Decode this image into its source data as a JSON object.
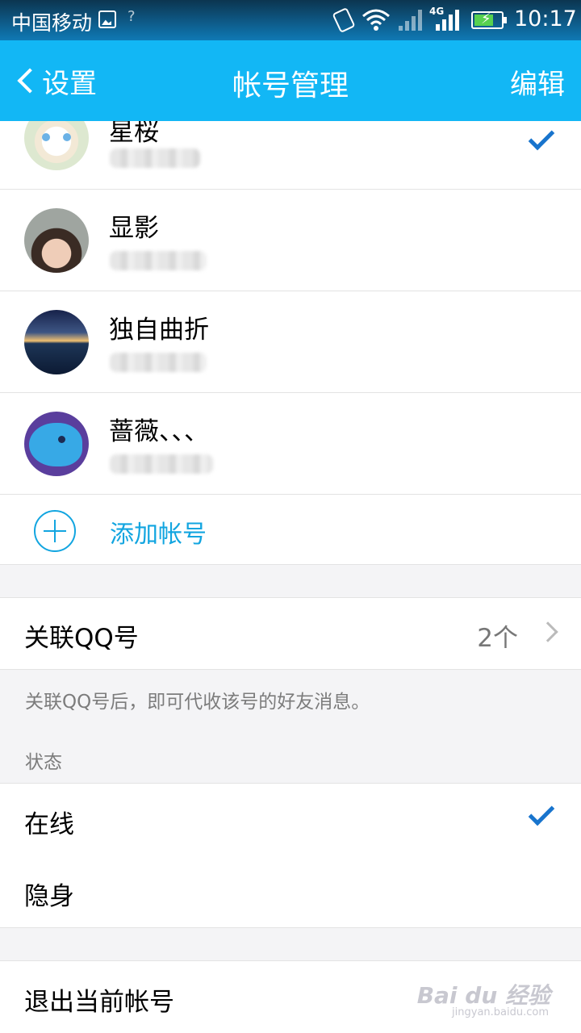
{
  "status_bar": {
    "carrier": "中国移动",
    "network": "4G",
    "time": "10:17",
    "battery_level": 0.72,
    "icons": [
      "image-icon",
      "wifi-question-icon",
      "vibrate-icon",
      "wifi-icon",
      "signal-icon",
      "battery-charging-icon"
    ]
  },
  "nav": {
    "back_label": "设置",
    "title": "帐号管理",
    "edit_label": "编辑"
  },
  "accounts": [
    {
      "name": "星桜",
      "selected": true
    },
    {
      "name": "显影",
      "selected": false
    },
    {
      "name": "独自曲折",
      "selected": false
    },
    {
      "name": "蔷薇、、、",
      "selected": false
    }
  ],
  "add_account_label": "添加帐号",
  "associated_qq": {
    "label": "关联QQ号",
    "count": "2个",
    "note": "关联QQ号后，即可代收该号的好友消息。"
  },
  "status_section": {
    "label": "状态",
    "options": [
      {
        "label": "在线",
        "selected": true
      },
      {
        "label": "隐身",
        "selected": false
      }
    ]
  },
  "logout_label": "退出当前帐号",
  "watermark": {
    "main": "Bai du 经验",
    "sub": "jingyan.baidu.com"
  },
  "colors": {
    "nav_bg": "#12b7f5",
    "accent": "#12a5e0",
    "check": "#1874cd"
  }
}
